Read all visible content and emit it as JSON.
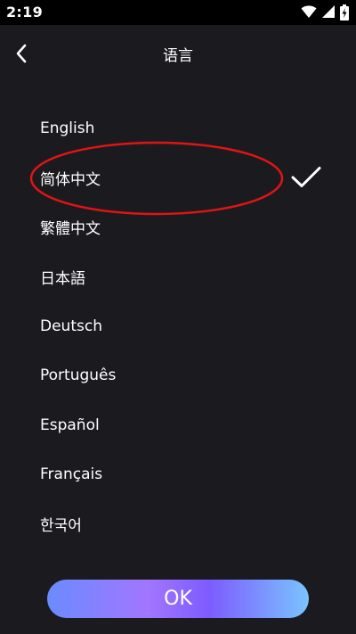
{
  "status_bar": {
    "time": "2:19",
    "icons": [
      "wifi-icon",
      "signal-icon",
      "battery-charging-icon"
    ]
  },
  "header": {
    "title": "语言",
    "back_icon": "chevron-left-icon"
  },
  "languages": [
    {
      "label": "English",
      "selected": false
    },
    {
      "label": "简体中文",
      "selected": true
    },
    {
      "label": "繁體中文",
      "selected": false
    },
    {
      "label": "日本語",
      "selected": false
    },
    {
      "label": "Deutsch",
      "selected": false
    },
    {
      "label": "Português",
      "selected": false
    },
    {
      "label": "Español",
      "selected": false
    },
    {
      "label": "Français",
      "selected": false
    },
    {
      "label": "한국어",
      "selected": false
    }
  ],
  "selected_icon": "checkmark-icon",
  "annotation_color": "#e01414",
  "ok_button": {
    "label": "OK"
  },
  "colors": {
    "background": "#1b1b1f",
    "text": "#ffffff",
    "status_bar": "#000000"
  }
}
